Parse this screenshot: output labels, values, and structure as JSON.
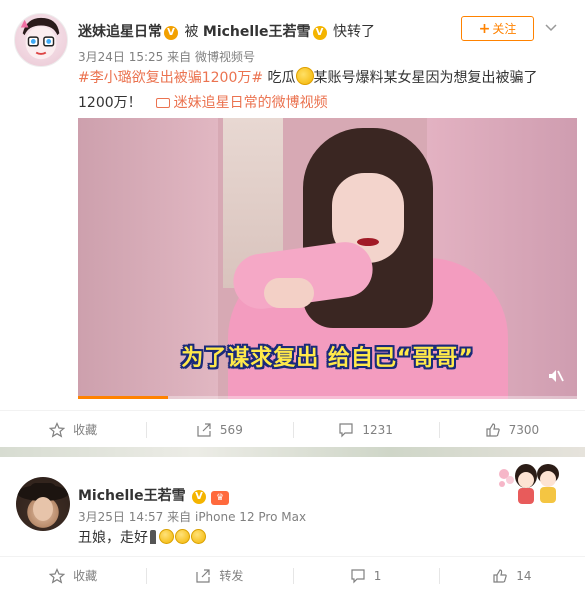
{
  "post": {
    "username": "迷妹追星日常",
    "verified_badge": "V",
    "repost_text": "被",
    "original_user": "Michelle王若雪",
    "repost_suffix": "快转了",
    "date": "3月24日 15:25",
    "source_prefix": "来自",
    "source": "微博视频号",
    "follow_label": "关注",
    "more_icon": "chevron-down-icon",
    "hashtag": "#李小璐欲复出被骗1200万#",
    "text_part1": "吃瓜",
    "text_part2": "某账号爆料某女星因为想复出被骗了1200万！",
    "video_link": "迷妹追星日常的微博视频",
    "video": {
      "subtitle": "为了谋求复出 给自己“哥哥”",
      "progress": 0.18
    },
    "actions": {
      "favorite": "收藏",
      "repost": "569",
      "comment": "1231",
      "like": "7300"
    }
  },
  "comment_post": {
    "username": "Michelle王若雪",
    "verified_badge": "V",
    "member_badge": "♛",
    "date": "3月25日 14:57",
    "source_prefix": "来自",
    "source": "iPhone 12 Pro Max",
    "text": "丑娘，走好",
    "actions": {
      "favorite": "收藏",
      "repost": "转发",
      "comment": "1",
      "like": "14"
    }
  },
  "colors": {
    "accent": "#ff8200",
    "link": "#eb7350",
    "muted": "#808080"
  }
}
